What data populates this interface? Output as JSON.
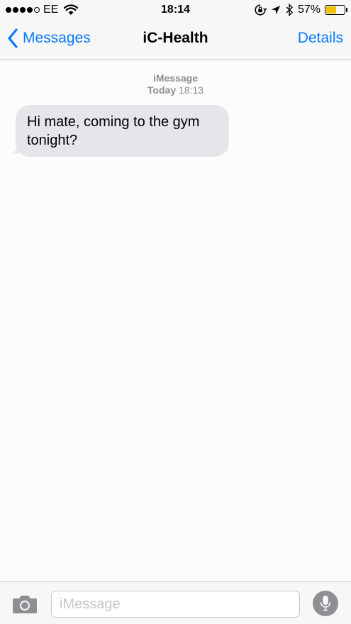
{
  "status_bar": {
    "carrier": "EE",
    "time": "18:14",
    "battery_percent": "57%",
    "battery_level": 0.57,
    "battery_color": "#f2c200",
    "icons": [
      "signal-dots-icon",
      "wifi-icon",
      "rotation-lock-icon",
      "location-arrow-icon",
      "bluetooth-icon",
      "battery-icon"
    ]
  },
  "nav": {
    "back_label": "Messages",
    "title": "iC-Health",
    "details_label": "Details",
    "accent_color": "#0a7aff"
  },
  "conversation": {
    "service": "iMessage",
    "day": "Today",
    "time": "18:13",
    "messages": [
      {
        "direction": "incoming",
        "text": "Hi mate, coming to the gym tonight?"
      }
    ],
    "incoming_bubble_color": "#e5e5ea"
  },
  "input_bar": {
    "placeholder": "iMessage",
    "camera_icon": "camera-icon",
    "mic_icon": "microphone-icon"
  }
}
